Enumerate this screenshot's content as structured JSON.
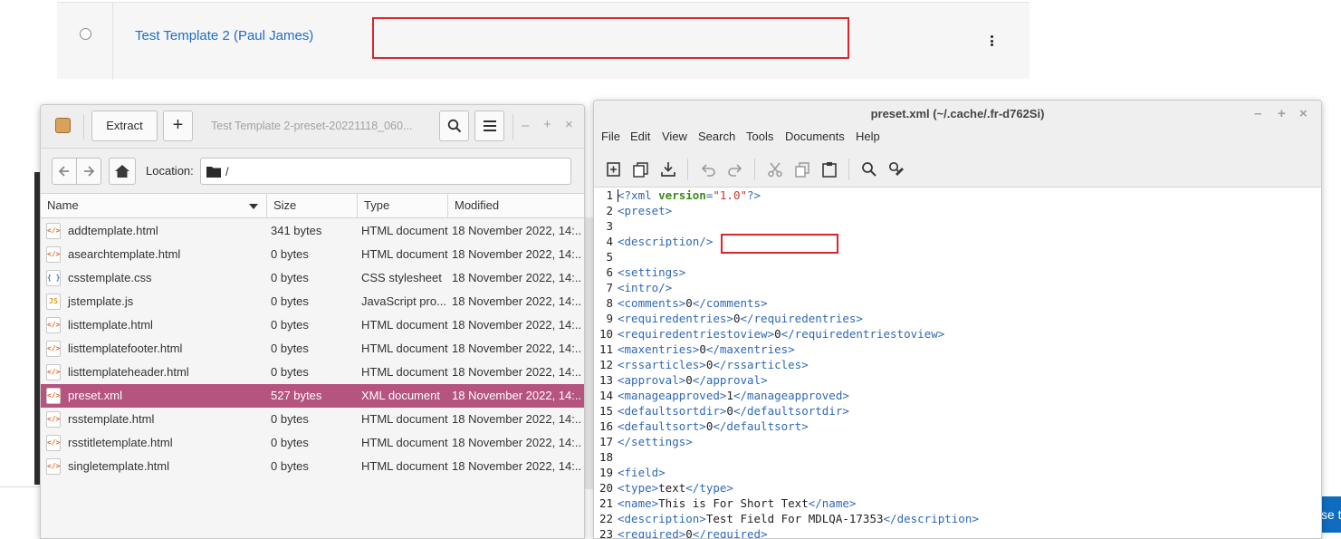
{
  "web": {
    "template_link": "Test Template 2 (Paul James)",
    "bottom_button_text": "se t"
  },
  "archive": {
    "title": "Test Template 2-preset-20221118_060...",
    "extract_label": "Extract",
    "add_label": "+",
    "minimize": "–",
    "maximize": "+",
    "close": "×",
    "location_label": "Location:",
    "location_path": "/",
    "columns": {
      "name": "Name",
      "size": "Size",
      "type": "Type",
      "modified": "Modified"
    },
    "files": [
      {
        "name": "addtemplate.html",
        "size": "341 bytes",
        "type": "HTML document",
        "modified": "18 November 2022, 14:...",
        "icon": "html-file-icon",
        "glyph": "</>"
      },
      {
        "name": "asearchtemplate.html",
        "size": "0 bytes",
        "type": "HTML document",
        "modified": "18 November 2022, 14:...",
        "icon": "html-file-icon",
        "glyph": "</>"
      },
      {
        "name": "csstemplate.css",
        "size": "0 bytes",
        "type": "CSS stylesheet",
        "modified": "18 November 2022, 14:...",
        "icon": "css-file-icon",
        "glyph": "{ }"
      },
      {
        "name": "jstemplate.js",
        "size": "0 bytes",
        "type": "JavaScript pro...",
        "modified": "18 November 2022, 14:...",
        "icon": "js-file-icon",
        "glyph": "JS"
      },
      {
        "name": "listtemplate.html",
        "size": "0 bytes",
        "type": "HTML document",
        "modified": "18 November 2022, 14:...",
        "icon": "html-file-icon",
        "glyph": "</>"
      },
      {
        "name": "listtemplatefooter.html",
        "size": "0 bytes",
        "type": "HTML document",
        "modified": "18 November 2022, 14:...",
        "icon": "html-file-icon",
        "glyph": "</>"
      },
      {
        "name": "listtemplateheader.html",
        "size": "0 bytes",
        "type": "HTML document",
        "modified": "18 November 2022, 14:...",
        "icon": "html-file-icon",
        "glyph": "</>"
      },
      {
        "name": "preset.xml",
        "size": "527 bytes",
        "type": "XML document",
        "modified": "18 November 2022, 14:...",
        "icon": "xml-file-icon",
        "glyph": "</>",
        "selected": true
      },
      {
        "name": "rsstemplate.html",
        "size": "0 bytes",
        "type": "HTML document",
        "modified": "18 November 2022, 14:...",
        "icon": "html-file-icon",
        "glyph": "</>"
      },
      {
        "name": "rsstitletemplate.html",
        "size": "0 bytes",
        "type": "HTML document",
        "modified": "18 November 2022, 14:...",
        "icon": "html-file-icon",
        "glyph": "</>"
      },
      {
        "name": "singletemplate.html",
        "size": "0 bytes",
        "type": "HTML document",
        "modified": "18 November 2022, 14:...",
        "icon": "html-file-icon",
        "glyph": "</>"
      }
    ],
    "selected_color": "#b5547f"
  },
  "editor": {
    "title": "preset.xml (~/.cache/.fr-d762Si)",
    "minimize": "–",
    "maximize": "+",
    "close": "×",
    "menu": [
      "File",
      "Edit",
      "View",
      "Search",
      "Tools",
      "Documents",
      "Help"
    ],
    "lines": [
      {
        "n": "1",
        "parts": [
          [
            "tag",
            "<?xml "
          ],
          [
            "attr",
            "version"
          ],
          [
            "tag",
            "="
          ],
          [
            "str",
            "\"1.0\""
          ],
          [
            "tag",
            "?>"
          ]
        ]
      },
      {
        "n": "2",
        "parts": [
          [
            "tag",
            "<preset>"
          ]
        ]
      },
      {
        "n": "3",
        "parts": []
      },
      {
        "n": "4",
        "parts": [
          [
            "tag",
            "<description/>"
          ]
        ]
      },
      {
        "n": "5",
        "parts": []
      },
      {
        "n": "6",
        "parts": [
          [
            "tag",
            "<settings>"
          ]
        ]
      },
      {
        "n": "7",
        "parts": [
          [
            "tag",
            "<intro/>"
          ]
        ]
      },
      {
        "n": "8",
        "parts": [
          [
            "tag",
            "<comments>"
          ],
          [
            "txt",
            "0"
          ],
          [
            "tag",
            "</comments>"
          ]
        ]
      },
      {
        "n": "9",
        "parts": [
          [
            "tag",
            "<requiredentries>"
          ],
          [
            "txt",
            "0"
          ],
          [
            "tag",
            "</requiredentries>"
          ]
        ]
      },
      {
        "n": "10",
        "parts": [
          [
            "tag",
            "<requiredentriestoview>"
          ],
          [
            "txt",
            "0"
          ],
          [
            "tag",
            "</requiredentriestoview>"
          ]
        ]
      },
      {
        "n": "11",
        "parts": [
          [
            "tag",
            "<maxentries>"
          ],
          [
            "txt",
            "0"
          ],
          [
            "tag",
            "</maxentries>"
          ]
        ]
      },
      {
        "n": "12",
        "parts": [
          [
            "tag",
            "<rssarticles>"
          ],
          [
            "txt",
            "0"
          ],
          [
            "tag",
            "</rssarticles>"
          ]
        ]
      },
      {
        "n": "13",
        "parts": [
          [
            "tag",
            "<approval>"
          ],
          [
            "txt",
            "0"
          ],
          [
            "tag",
            "</approval>"
          ]
        ]
      },
      {
        "n": "14",
        "parts": [
          [
            "tag",
            "<manageapproved>"
          ],
          [
            "txt",
            "1"
          ],
          [
            "tag",
            "</manageapproved>"
          ]
        ]
      },
      {
        "n": "15",
        "parts": [
          [
            "tag",
            "<defaultsortdir>"
          ],
          [
            "txt",
            "0"
          ],
          [
            "tag",
            "</defaultsortdir>"
          ]
        ]
      },
      {
        "n": "16",
        "parts": [
          [
            "tag",
            "<defaultsort>"
          ],
          [
            "txt",
            "0"
          ],
          [
            "tag",
            "</defaultsort>"
          ]
        ]
      },
      {
        "n": "17",
        "parts": [
          [
            "tag",
            "</settings>"
          ]
        ]
      },
      {
        "n": "18",
        "parts": []
      },
      {
        "n": "19",
        "parts": [
          [
            "tag",
            "<field>"
          ]
        ]
      },
      {
        "n": "20",
        "parts": [
          [
            "tag",
            "<type>"
          ],
          [
            "txt",
            "text"
          ],
          [
            "tag",
            "</type>"
          ]
        ]
      },
      {
        "n": "21",
        "parts": [
          [
            "tag",
            "<name>"
          ],
          [
            "txt",
            "This is For Short Text"
          ],
          [
            "tag",
            "</name>"
          ]
        ]
      },
      {
        "n": "22",
        "parts": [
          [
            "tag",
            "<description>"
          ],
          [
            "txt",
            "Test Field For MDLQA-17353"
          ],
          [
            "tag",
            "</description>"
          ]
        ]
      },
      {
        "n": "23",
        "parts": [
          [
            "tag",
            "<required>"
          ],
          [
            "txt",
            "0"
          ],
          [
            "tag",
            "</required>"
          ]
        ]
      }
    ]
  },
  "colors": {
    "highlight_red": "#d9262c",
    "link_blue": "#1f6fc1",
    "xml_tag": "#2f69b5",
    "xml_attr": "#3a8a17",
    "xml_string": "#c0392b"
  }
}
